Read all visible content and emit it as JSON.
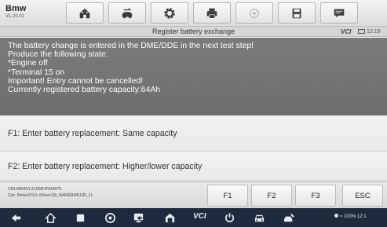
{
  "app": {
    "name": "Bmw",
    "version": "V1.20.01"
  },
  "toolbar": {
    "buttons": [
      {
        "icon": "home-icon"
      },
      {
        "icon": "vehicle-swap-icon"
      },
      {
        "icon": "gear-icon"
      },
      {
        "icon": "printer-icon"
      },
      {
        "icon": "help-icon"
      },
      {
        "icon": "save-icon"
      },
      {
        "icon": "message-icon"
      }
    ]
  },
  "titlebar": {
    "title": "Register battery exchange",
    "vci_label": "VCI",
    "time": "12:19"
  },
  "message": {
    "lines": [
      "The battery change is entered in the DME/DDE in the next test step!",
      "Produce the following state:",
      "*Engine off",
      "*Terminal 15 on",
      "Important! Entry cannot be cancelled!",
      "Currently registered battery capacity:64Ah"
    ]
  },
  "options": [
    "F1: Enter battery replacement: Same capacity",
    "F2: Enter battery replacement: Higher/lower capacity"
  ],
  "footer": {
    "vin": "VIN:WBAVL3105BVN94875",
    "car": "Car: Bmw/X/X1 sDrive18i_N46/E84/EUR_LL",
    "buttons": [
      "F1",
      "F2",
      "F3",
      "ESC"
    ]
  },
  "navbar": {
    "vci_label": "VCI",
    "status_text": "100%",
    "time": "12:1"
  }
}
